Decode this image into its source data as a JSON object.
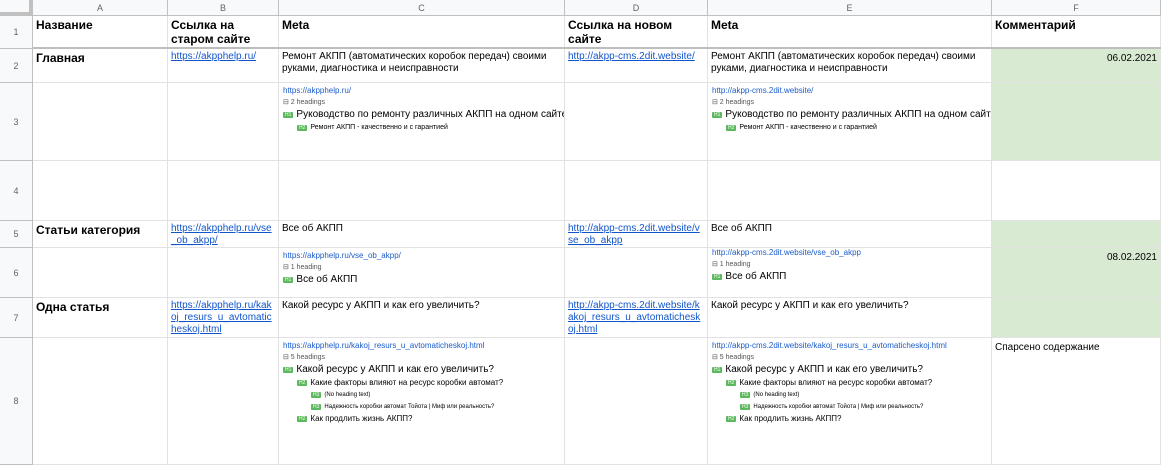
{
  "columns": [
    "A",
    "B",
    "C",
    "D",
    "E",
    "F"
  ],
  "rows": [
    "1",
    "2",
    "3",
    "4",
    "5",
    "6",
    "7",
    "8"
  ],
  "headers": {
    "a": "Название",
    "b": "Ссылка на старом сайте",
    "c": "Meta",
    "d": "Ссылка на новом сайте",
    "e": "Meta",
    "f": "Комментарий"
  },
  "r2": {
    "a": "Главная",
    "b": "https://akpphelp.ru/",
    "c": "Ремонт АКПП (автоматических коробок передач) своими руками, диагностика и неисправности",
    "d": "http://akpp-cms.2dit.website/",
    "e": "Ремонт АКПП (автоматических коробок передач) своими руками, диагностика и неисправности",
    "f": "06.02.2021"
  },
  "r3": {
    "c": {
      "url": "https://akpphelp.ru/",
      "count": "⊟ 2 headings",
      "h1": "Руководство по ремонту различных АКПП на одном сайте",
      "h2": "Ремонт АКПП - качественно и с гарантией"
    },
    "e": {
      "url": "http://akpp-cms.2dit.website/",
      "count": "⊟ 2 headings",
      "h1": "Руководство по ремонту различных АКПП на одном сайте",
      "h2": "Ремонт АКПП - качественно и с гарантией"
    }
  },
  "r5": {
    "a": "Статьи категория",
    "b": "https://akpphelp.ru/vse_ob_akpp/",
    "c": "Все об АКПП",
    "d": "http://akpp-cms.2dit.website/vse_ob_akpp",
    "e": "Все об АКПП"
  },
  "r6": {
    "c": {
      "url": "https://akpphelp.ru/vse_ob_akpp/",
      "count": "⊟ 1 heading",
      "h1": "Все об АКПП"
    },
    "e": {
      "url": "http://akpp-cms.2dit.website/vse_ob_akpp",
      "count": "⊟ 1 heading",
      "h1": "Все об АКПП"
    },
    "f": "08.02.2021"
  },
  "r7": {
    "a": "Одна статья",
    "b": "https://akpphelp.ru/kakoj_resurs_u_avtomaticheskoj.html",
    "c": "Какой ресурс у АКПП и как его увеличить?",
    "d": "http://akpp-cms.2dit.website/kakoj_resurs_u_avtomaticheskoj.html",
    "e": "Какой ресурс у АКПП и как его увеличить?"
  },
  "r8": {
    "c": {
      "url": "https://akpphelp.ru/kakoj_resurs_u_avtomaticheskoj.html",
      "count": "⊟ 5 headings",
      "h1": "Какой ресурс у АКПП и как его увеличить?",
      "h2a": "Какие факторы влияют на ресурс коробки автомат?",
      "h3a": "(No heading text)",
      "h3b": "Надежность коробки автомат Тойота | Миф или реальность?",
      "h2b": "Как продлить жизнь АКПП?"
    },
    "e": {
      "url": "http://akpp-cms.2dit.website/kakoj_resurs_u_avtomaticheskoj.html",
      "count": "⊟ 5 headings",
      "h1": "Какой ресурс у АКПП и как его увеличить?",
      "h2a": "Какие факторы влияют на ресурс коробки автомат?",
      "h3a": "(No heading text)",
      "h3b": "Надежность коробки автомат Тойота | Миф или реальность?",
      "h2b": "Как продлить жизнь АКПП?"
    },
    "f": "Спарсено содержание"
  },
  "tags": {
    "h1": "H1",
    "h2": "H2",
    "h3": "H3"
  },
  "colors": {
    "green_fill": "#d9ead3",
    "link": "#1155cc",
    "heading_tag": "#5cb85c"
  }
}
